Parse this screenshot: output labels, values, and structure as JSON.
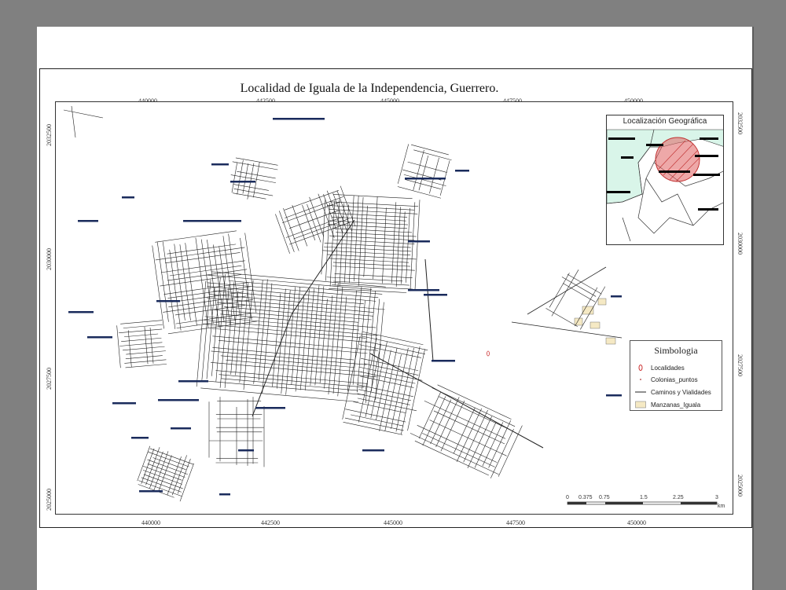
{
  "map": {
    "title": "Localidad de Iguala de la Independencia, Guerrero.",
    "x_ticks": [
      "440000",
      "442500",
      "445000",
      "447500",
      "450000"
    ],
    "y_ticks": [
      "2032500",
      "2030000",
      "2027500",
      "2025000"
    ],
    "colors": {
      "roads": "#222222",
      "blocks_fill": "#f5e9c4",
      "labels": "#1a2b5c",
      "localidades": "#cc3333",
      "inset_state_fill": "#d9f5e9",
      "inset_area": "#e06060"
    }
  },
  "inset": {
    "title": "Localización Geográfica"
  },
  "legend": {
    "title": "Simbologia",
    "items": [
      {
        "label": "Localidades",
        "icon": "location-marker-icon"
      },
      {
        "label": "Colonias_puntos",
        "icon": "point-icon"
      },
      {
        "label": "Caminos y Vialidades",
        "icon": "line-icon"
      },
      {
        "label": "Manzanas_Iguala",
        "icon": "polygon-fill-icon"
      }
    ]
  },
  "scale": {
    "labels": [
      "0",
      "0.375",
      "0.75",
      "1.5",
      "2.25",
      "3"
    ],
    "unit": "km"
  }
}
